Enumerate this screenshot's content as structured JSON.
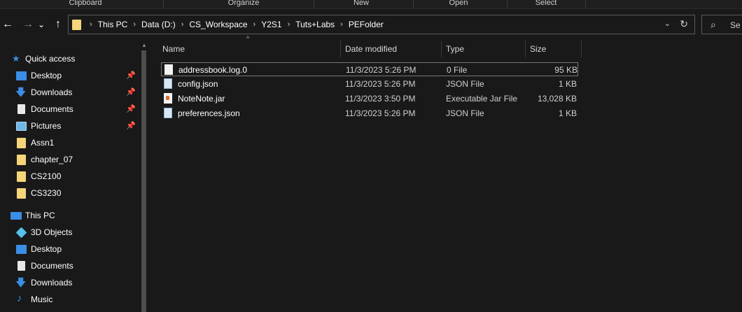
{
  "ribbon": {
    "groups": [
      "Clipboard",
      "Organize",
      "New",
      "Open",
      "Select"
    ]
  },
  "nav": {
    "back": "←",
    "forward": "→",
    "recent": "⌄",
    "up": "↑"
  },
  "address": {
    "crumbs": [
      "This PC",
      "Data (D:)",
      "CS_Workspace",
      "Y2S1",
      "Tuts+Labs",
      "PEFolder"
    ]
  },
  "search": {
    "placeholder": "Se"
  },
  "sidebar": {
    "quick_access": "Quick access",
    "quick_items": [
      {
        "label": "Desktop",
        "icon": "desktop-icon",
        "pinned": true
      },
      {
        "label": "Downloads",
        "icon": "download-icon",
        "pinned": true
      },
      {
        "label": "Documents",
        "icon": "document-icon",
        "pinned": true
      },
      {
        "label": "Pictures",
        "icon": "pictures-icon",
        "pinned": true
      },
      {
        "label": "Assn1",
        "icon": "folder-icon",
        "pinned": false
      },
      {
        "label": "chapter_07",
        "icon": "folder-icon",
        "pinned": false
      },
      {
        "label": "CS2100",
        "icon": "folder-icon",
        "pinned": false
      },
      {
        "label": "CS3230",
        "icon": "folder-icon",
        "pinned": false
      }
    ],
    "this_pc": "This PC",
    "pc_items": [
      {
        "label": "3D Objects",
        "icon": "3d-objects-icon"
      },
      {
        "label": "Desktop",
        "icon": "desktop-icon"
      },
      {
        "label": "Documents",
        "icon": "document-icon"
      },
      {
        "label": "Downloads",
        "icon": "download-icon"
      },
      {
        "label": "Music",
        "icon": "music-icon"
      }
    ]
  },
  "columns": {
    "name": "Name",
    "date": "Date modified",
    "type": "Type",
    "size": "Size"
  },
  "files": [
    {
      "name": "addressbook.log.0",
      "date": "11/3/2023 5:26 PM",
      "type": "0 File",
      "size": "95 KB",
      "icon": "file-icon"
    },
    {
      "name": "config.json",
      "date": "11/3/2023 5:26 PM",
      "type": "JSON File",
      "size": "1 KB",
      "icon": "json-file-icon"
    },
    {
      "name": "NoteNote.jar",
      "date": "11/3/2023 3:50 PM",
      "type": "Executable Jar File",
      "size": "13,028 KB",
      "icon": "jar-file-icon"
    },
    {
      "name": "preferences.json",
      "date": "11/3/2023 5:26 PM",
      "type": "JSON File",
      "size": "1 KB",
      "icon": "json-file-icon"
    }
  ],
  "colors": {
    "background": "#191919",
    "accent": "#3a8ee6",
    "folder": "#f4d57a"
  }
}
